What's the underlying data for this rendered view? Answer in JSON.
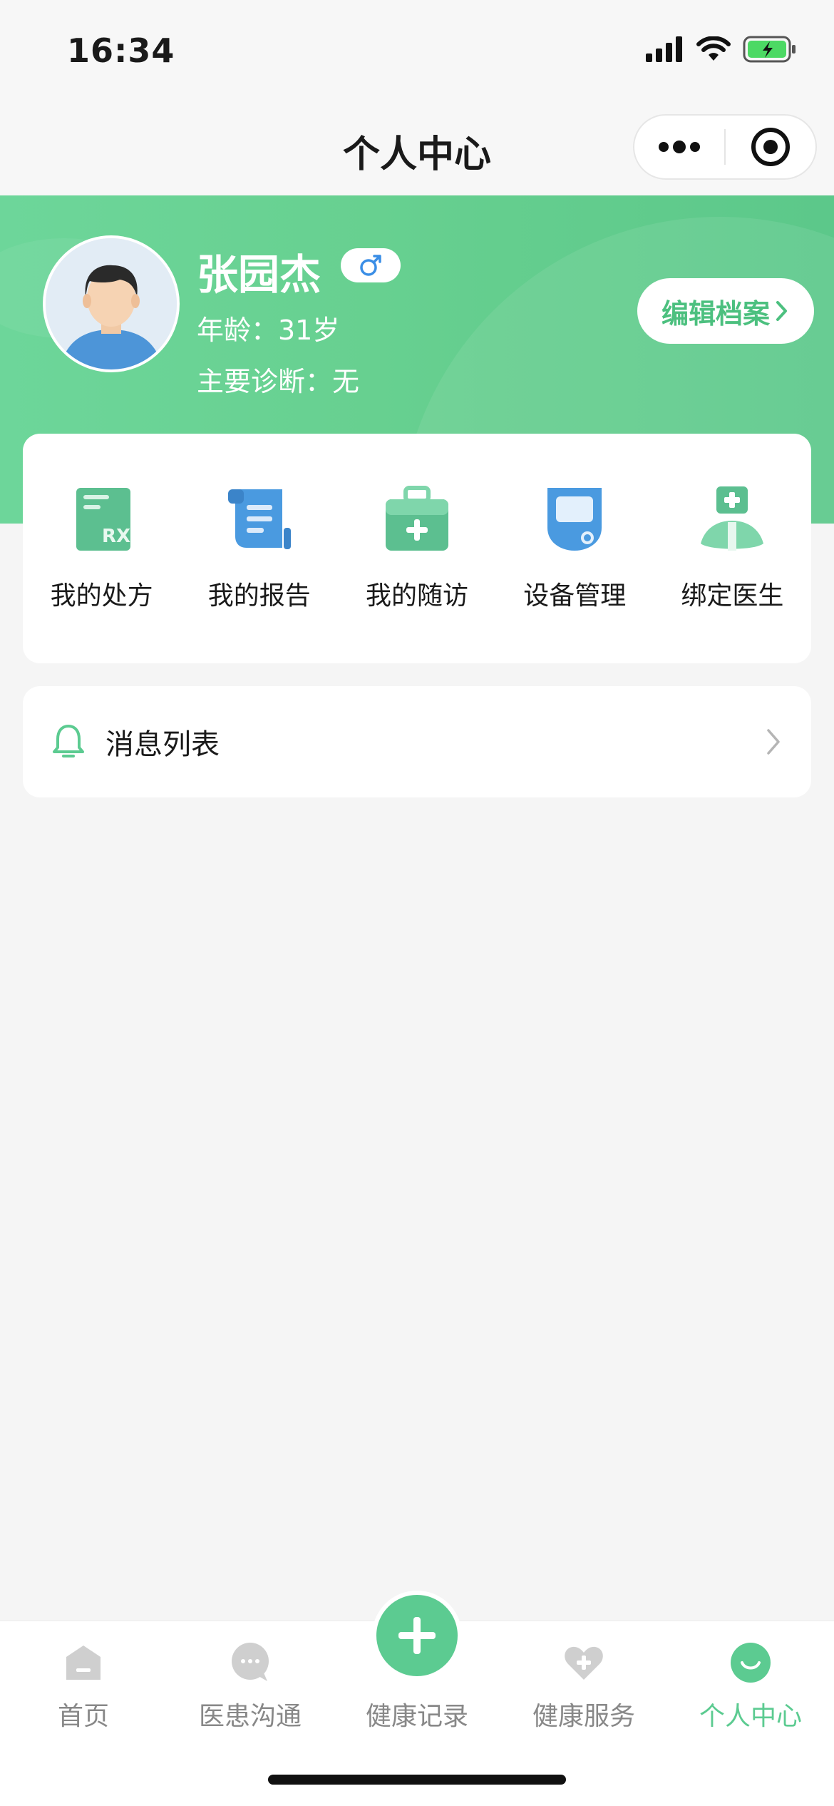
{
  "status_bar": {
    "time": "16:34"
  },
  "nav": {
    "title": "个人中心",
    "more_icon": "more-icon",
    "target_icon": "target-icon"
  },
  "profile": {
    "name": "张园杰",
    "gender_icon": "male-icon",
    "age": "年龄：31岁",
    "diagnosis": "主要诊断：无",
    "edit_button": "编辑档案",
    "colors": {
      "accent": "#5ccb91",
      "header_green": "#67d090"
    }
  },
  "functions": [
    {
      "label": "我的处方",
      "icon": "prescription-icon"
    },
    {
      "label": "我的报告",
      "icon": "report-icon"
    },
    {
      "label": "我的随访",
      "icon": "follow-up-icon"
    },
    {
      "label": "设备管理",
      "icon": "device-icon"
    },
    {
      "label": "绑定医生",
      "icon": "doctor-icon"
    }
  ],
  "messages": {
    "label": "消息列表",
    "icon": "bell-icon"
  },
  "tabs": [
    {
      "label": "首页",
      "icon": "home-icon"
    },
    {
      "label": "医患沟通",
      "icon": "chat-icon"
    },
    {
      "label": "健康记录",
      "icon": "plus-icon"
    },
    {
      "label": "健康服务",
      "icon": "heart-plus-icon"
    },
    {
      "label": "个人中心",
      "icon": "profile-icon",
      "active": true
    }
  ]
}
